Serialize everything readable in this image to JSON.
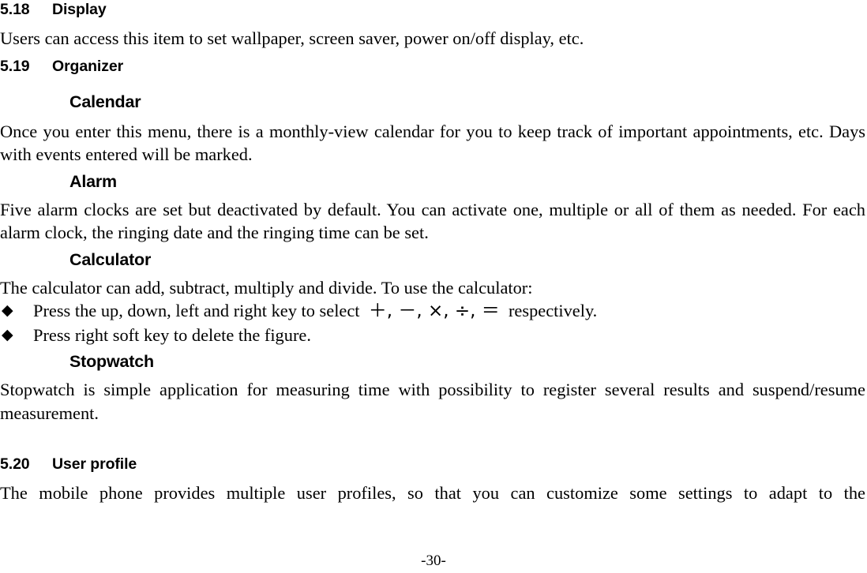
{
  "document": {
    "footer_page_number": "-30-"
  },
  "sections": [
    {
      "number": "5.18",
      "title": "Display",
      "paragraph": "Users can access this item to set wallpaper, screen saver, power on/off display, etc."
    },
    {
      "number": "5.19",
      "title": "Organizer"
    },
    {
      "number": "5.20",
      "title": "User profile",
      "paragraph": "The mobile phone provides multiple user profiles, so that you can customize some settings to adapt to the"
    }
  ],
  "subsections": {
    "calendar": {
      "title": "Calendar",
      "paragraph": "Once you enter this menu, there is a monthly-view calendar for you to keep track of important appointments, etc. Days with events entered will be marked."
    },
    "alarm": {
      "title": "Alarm",
      "paragraph": "Five alarm clocks are set but deactivated by default. You can activate one, multiple or all of them as needed. For each alarm clock, the ringing date and the ringing time can be set."
    },
    "calculator": {
      "title": "Calculator",
      "paragraph": "The calculator can add, subtract, multiply and divide. To use the calculator:",
      "bullets": [
        {
          "marker": "◆",
          "text_before": "Press the up, down, left and right key to select",
          "symbols": "＋, －, ×, ÷, ＝",
          "symbol_list": [
            "＋",
            "－",
            "×",
            "÷",
            "＝"
          ],
          "text_after": "respectively."
        },
        {
          "marker": "◆",
          "text_before": "Press right soft key to delete the figure.",
          "symbols": "",
          "text_after": ""
        }
      ]
    },
    "stopwatch": {
      "title": "Stopwatch",
      "paragraph": "Stopwatch is simple application for measuring time with possibility to register several results and suspend/resume measurement."
    }
  }
}
